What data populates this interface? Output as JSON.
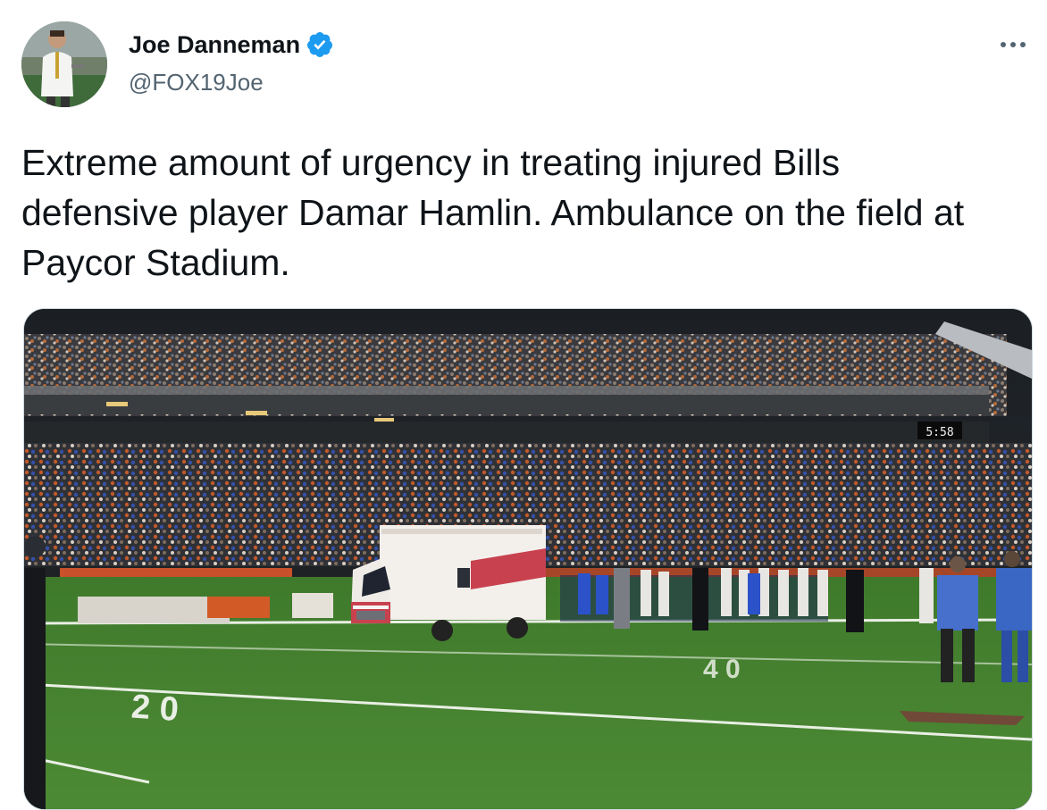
{
  "author": {
    "display_name": "Joe Danneman",
    "handle": "@FOX19Joe",
    "verified_icon": "verified-badge-icon",
    "badge_color": "#1d9bf0"
  },
  "more_icon": "more-horizontal-icon",
  "tweet": {
    "text": "Extreme amount of urgency in treating injured Bills defensive player Damar Hamlin. Ambulance on the field at Paycor Stadium."
  },
  "media": {
    "scoreboard_clock": "5:58"
  }
}
